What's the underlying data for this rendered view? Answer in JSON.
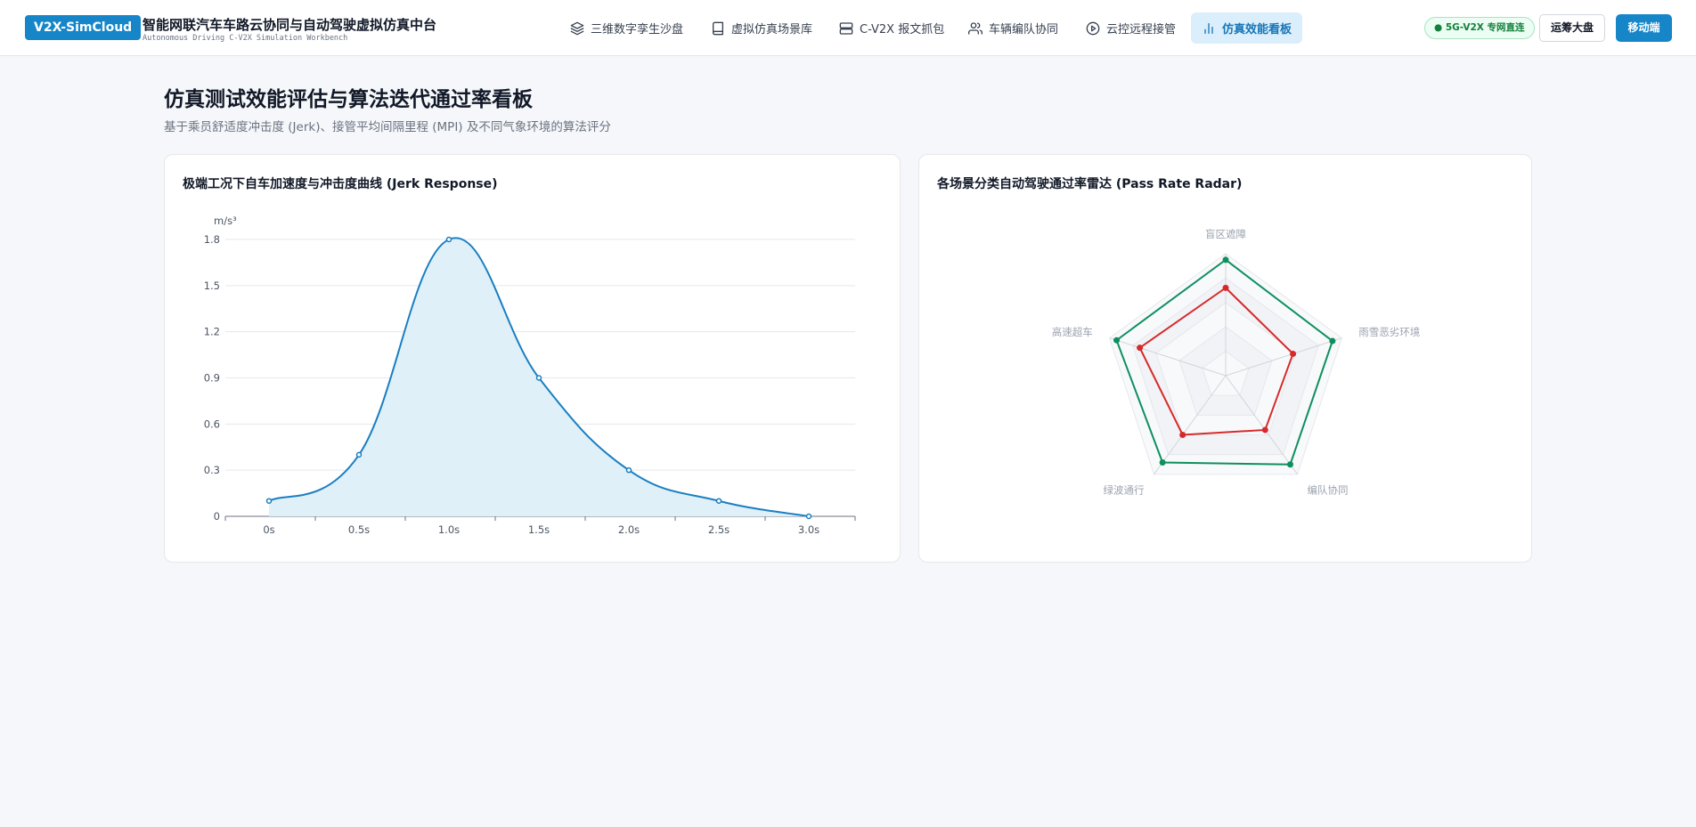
{
  "header": {
    "logo": "V2X-SimCloud",
    "title": "智能网联汽车车路云协同与自动驾驶虚拟仿真中台",
    "subtitle": "Autonomous Driving C-V2X Simulation Workbench",
    "nav": [
      {
        "label": "三维数字孪生沙盘",
        "icon": "layers-icon"
      },
      {
        "label": "虚拟仿真场景库",
        "icon": "book-icon"
      },
      {
        "label": "C-V2X 报文抓包",
        "icon": "server-icon"
      },
      {
        "label": "车辆编队协同",
        "icon": "users-icon"
      },
      {
        "label": "云控远程接管",
        "icon": "play-circle-icon"
      },
      {
        "label": "仿真效能看板",
        "icon": "bar-chart-icon",
        "active": true
      }
    ],
    "network_badge": "● 5G-V2X 专网直连",
    "btn_ops": "运筹大盘",
    "btn_mobile": "移动端"
  },
  "page": {
    "title": "仿真测试效能评估与算法迭代通过率看板",
    "description": "基于乘员舒适度冲击度 (Jerk)、接管平均间隔里程 (MPI) 及不同气象环境的算法评分"
  },
  "chart_data": [
    {
      "type": "area",
      "title": "极端工况下自车加速度与冲击度曲线 (Jerk Response)",
      "ylabel": "m/s³",
      "categories": [
        "0s",
        "0.5s",
        "1.0s",
        "1.5s",
        "2.0s",
        "2.5s",
        "3.0s"
      ],
      "values": [
        0.1,
        0.4,
        1.8,
        0.9,
        0.3,
        0.1,
        0
      ],
      "yticks": [
        "0",
        "0.3",
        "0.6",
        "0.9",
        "1.2",
        "1.5",
        "1.8"
      ],
      "ylim": [
        0,
        1.8
      ],
      "color": "#1a7fc1",
      "fill": "#e0f0f9"
    },
    {
      "type": "radar",
      "title": "各场景分类自动驾驶通过率雷达 (Pass Rate Radar)",
      "axes": [
        "盲区遮障",
        "雨雪恶劣环境",
        "编队协同",
        "绿波通行",
        "高速超车"
      ],
      "rmax": 100,
      "series": [
        {
          "values": [
            95,
            92,
            90,
            88,
            94
          ],
          "color": "#0e8f5e"
        },
        {
          "values": [
            72,
            58,
            55,
            60,
            74
          ],
          "color": "#d62a2a"
        }
      ]
    }
  ]
}
